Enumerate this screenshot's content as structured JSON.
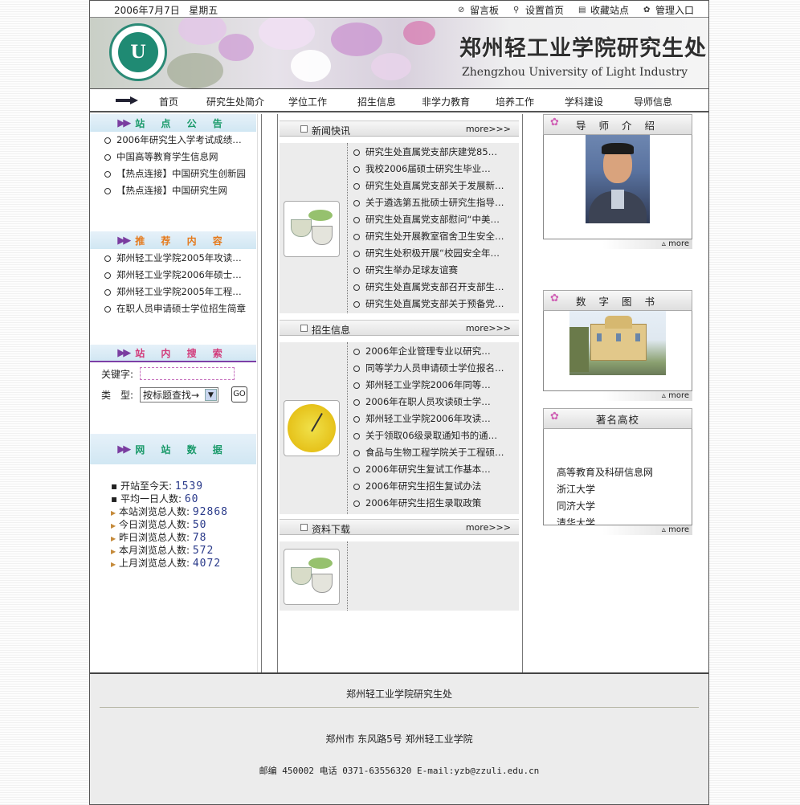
{
  "topbar": {
    "date": "2006年7月7日",
    "weekday": "星期五",
    "links": [
      {
        "label": "留言板",
        "icon": "clock-icon"
      },
      {
        "label": "设置首页",
        "icon": "search-icon"
      },
      {
        "label": "收藏站点",
        "icon": "document-icon"
      },
      {
        "label": "管理入口",
        "icon": "users-icon"
      }
    ]
  },
  "banner": {
    "title_cn": "郑州轻工业学院研究生处",
    "title_en": "Zhengzhou University of Light Industry"
  },
  "nav": [
    "首页",
    "研究生处简介",
    "学位工作",
    "招生信息",
    "非学力教育",
    "培养工作",
    "学科建设",
    "导师信息"
  ],
  "left": {
    "notice_title": "站 点 公 告",
    "notices": [
      "2006年研究生入学考试成绩…",
      "中国高等教育学生信息网",
      "【热点连接】中国研究生创新园",
      "【热点连接】中国研究生网"
    ],
    "recommend_title": "推 荐 内 容",
    "recommends": [
      "郑州轻工业学院2005年攻读…",
      "郑州轻工业学院2006年硕士…",
      "郑州轻工业学院2005年工程…",
      "在职人员申请硕士学位招生简章"
    ],
    "search_title": "站 内 搜 索",
    "search": {
      "keyword_label": "关键字:",
      "type_label": "类　型:",
      "type_value": "按标题查找→",
      "go": "GO"
    },
    "stats_title": "网 站 数 据",
    "stats": [
      {
        "label": "开站至今天:",
        "value": "1539"
      },
      {
        "label": "平均一日人数:",
        "value": "60"
      },
      {
        "label": "本站浏览总人数:",
        "value": "92868"
      },
      {
        "label": "今日浏览总人数:",
        "value": "50"
      },
      {
        "label": "昨日浏览总人数:",
        "value": "78"
      },
      {
        "label": "本月浏览总人数:",
        "value": "572"
      },
      {
        "label": "上月浏览总人数:",
        "value": "4072"
      }
    ]
  },
  "middle": {
    "more": "more>>>",
    "news_title": "新闻快讯",
    "news": [
      "研究生处直属党支部庆建党85…",
      "我校2006届硕士研究生毕业…",
      "研究生处直属党支部关于发展新…",
      "关于遴选第五批硕士研究生指导…",
      "研究生处直属党支部慰问“中美…",
      "研究生处开展教室宿舍卫生安全…",
      "研究生处积极开展“校园安全年…",
      "研究生举办足球友谊赛",
      "研究生处直属党支部召开支部生…",
      "研究生处直属党支部关于预备党…"
    ],
    "admit_title": "招生信息",
    "admit": [
      "2006年企业管理专业以研究…",
      "同等学力人员申请硕士学位报名…",
      "郑州轻工业学院2006年同等…",
      "2006年在职人员攻读硕士学…",
      "郑州轻工业学院2006年攻读…",
      "关于领取06级录取通知书的通…",
      "食品与生物工程学院关于工程硕…",
      "2006年研究生复试工作基本…",
      "2006年研究生招生复试办法",
      "2006年研究生招生录取政策"
    ],
    "download_title": "资料下载"
  },
  "right": {
    "tutor_title": "导 师 介 绍",
    "library_title": "数 字 图 书",
    "schools_title": "著名高校",
    "schools": [
      "高等教育及科研信息网",
      "浙江大学",
      "同济大学",
      "清华大学"
    ],
    "more": "more"
  },
  "footer": {
    "org": "郑州轻工业学院研究生处",
    "address": "郑州市 东风路5号 郑州轻工业学院",
    "contact": "邮编 450002 电话 0371-63556320 E-mail:yzb@zzuli.edu.cn"
  }
}
